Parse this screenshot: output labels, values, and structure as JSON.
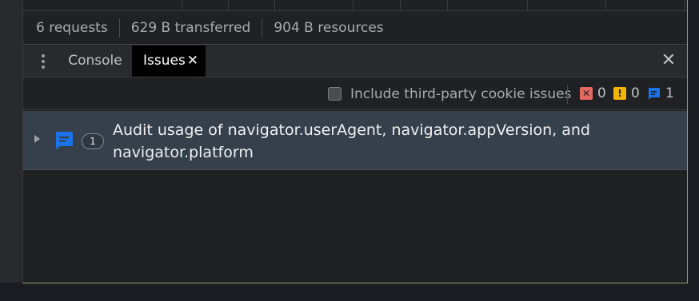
{
  "summary": {
    "requests": "6 requests",
    "transferred": "629 B transferred",
    "resources": "904 B resources"
  },
  "tabs": {
    "console": "Console",
    "issues": "Issues",
    "close_glyph": "✕"
  },
  "toolbar": {
    "third_party_label": "Include third-party cookie issues",
    "third_party_checked": false,
    "error_count": "0",
    "warning_count": "0",
    "info_count": "1"
  },
  "issues": [
    {
      "count": "1",
      "title": "Audit usage of navigator.userAgent, navigator.appVersion, and navigator.platform"
    }
  ],
  "colors": {
    "error": "#e46962",
    "warning": "#f2b500",
    "info": "#1a73e8"
  }
}
